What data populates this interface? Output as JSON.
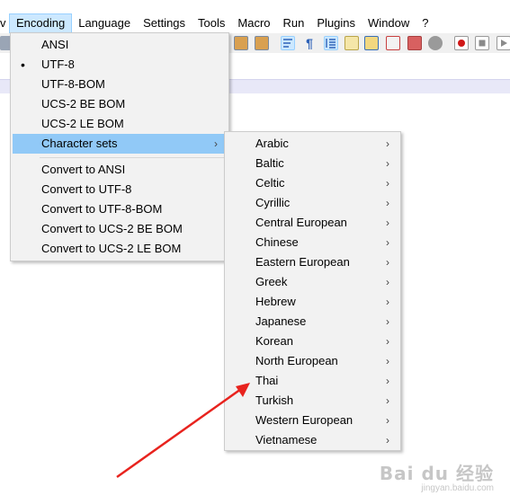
{
  "menubar": {
    "items": [
      "v",
      "Encoding",
      "Language",
      "Settings",
      "Tools",
      "Macro",
      "Run",
      "Plugins",
      "Window",
      "?"
    ]
  },
  "encoding_menu": {
    "items": [
      {
        "label": "ANSI"
      },
      {
        "label": "UTF-8",
        "checked": true
      },
      {
        "label": "UTF-8-BOM"
      },
      {
        "label": "UCS-2 BE BOM"
      },
      {
        "label": "UCS-2 LE BOM"
      },
      {
        "label": "Character sets",
        "submenu": true,
        "highlighted": true
      },
      {
        "label": "Convert to ANSI"
      },
      {
        "label": "Convert to UTF-8"
      },
      {
        "label": "Convert to UTF-8-BOM"
      },
      {
        "label": "Convert to UCS-2 BE BOM"
      },
      {
        "label": "Convert to UCS-2 LE BOM"
      }
    ],
    "check_glyph": "•"
  },
  "charsets_menu": {
    "items": [
      {
        "label": "Arabic"
      },
      {
        "label": "Baltic"
      },
      {
        "label": "Celtic"
      },
      {
        "label": "Cyrillic"
      },
      {
        "label": "Central European"
      },
      {
        "label": "Chinese"
      },
      {
        "label": "Eastern European"
      },
      {
        "label": "Greek"
      },
      {
        "label": "Hebrew"
      },
      {
        "label": "Japanese"
      },
      {
        "label": "Korean"
      },
      {
        "label": "North European"
      },
      {
        "label": "Thai"
      },
      {
        "label": "Turkish"
      },
      {
        "label": "Western European"
      },
      {
        "label": "Vietnamese"
      }
    ],
    "arrow_glyph": "›"
  },
  "annotation": {
    "color": "#e8231e"
  },
  "watermark": {
    "logo": "Bai du 经验",
    "url": "jingyan.baidu.com"
  }
}
